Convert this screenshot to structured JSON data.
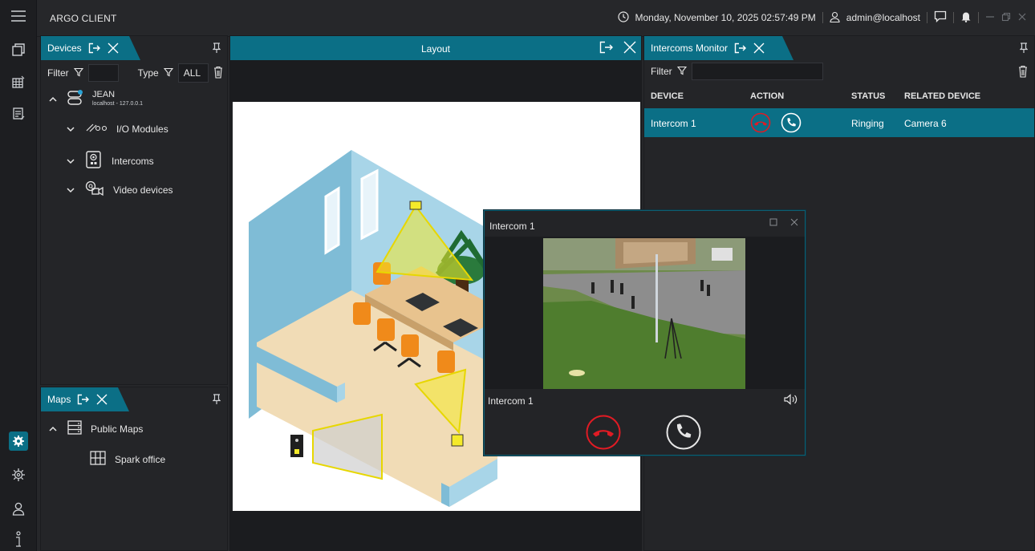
{
  "app": {
    "title": "ARGO CLIENT"
  },
  "topbar": {
    "datetime": "Monday, November 10, 2025 02:57:49 PM",
    "user": "admin@localhost"
  },
  "devices": {
    "tab_label": "Devices",
    "filter_label": "Filter",
    "type_label": "Type",
    "type_value": "ALL",
    "server": {
      "name": "JEAN",
      "address": "localhost - 127.0.0.1"
    },
    "items": [
      {
        "label": "I/O Modules"
      },
      {
        "label": "Intercoms"
      },
      {
        "label": "Video devices"
      }
    ]
  },
  "maps": {
    "tab_label": "Maps",
    "root": "Public Maps",
    "items": [
      {
        "label": "Spark office"
      }
    ]
  },
  "layout": {
    "title": "Layout"
  },
  "intercoms_monitor": {
    "tab_label": "Intercoms Monitor",
    "filter_label": "Filter",
    "columns": [
      "DEVICE",
      "ACTION",
      "STATUS",
      "RELATED DEVICE"
    ],
    "rows": [
      {
        "device": "Intercom 1",
        "status": "Ringing",
        "related": "Camera 6"
      }
    ]
  },
  "popup": {
    "title": "Intercom 1",
    "footer_label": "Intercom 1"
  },
  "colors": {
    "accent": "#0b6f86",
    "hangup": "#e01b24",
    "panel": "#242528"
  }
}
